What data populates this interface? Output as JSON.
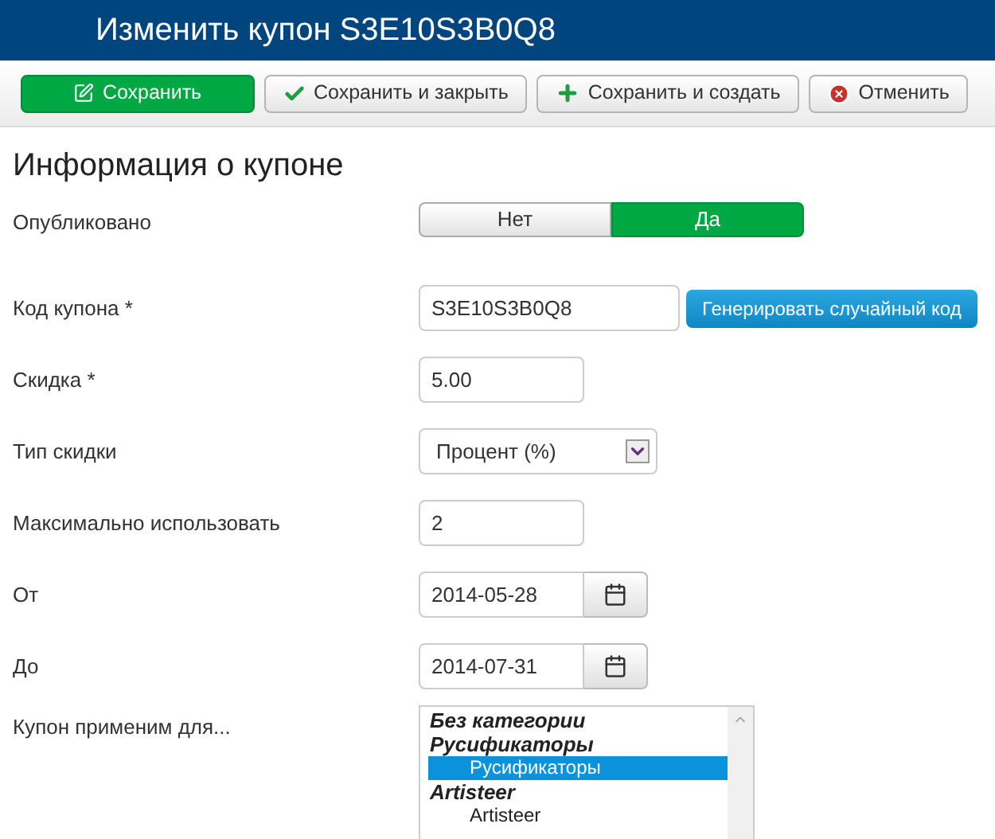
{
  "header": {
    "title": "Изменить купон S3E10S3B0Q8"
  },
  "toolbar": [
    {
      "kind": "save",
      "label": "Сохранить"
    },
    {
      "kind": "check",
      "label": "Сохранить и закрыть"
    },
    {
      "kind": "plus",
      "label": "Сохранить и создать"
    },
    {
      "kind": "cancel",
      "label": "Отменить"
    }
  ],
  "section_title": "Информация о купоне",
  "fields": [
    {
      "kind": "toggle",
      "label": "Опубликовано",
      "options": [
        {
          "label": "Нет",
          "selected": false
        },
        {
          "label": "Да",
          "selected": true
        }
      ]
    },
    {
      "kind": "text",
      "label": "Код купона *",
      "value": "S3E10S3B0Q8",
      "button": "Генерировать случайный код"
    },
    {
      "kind": "text",
      "label": "Скидка *",
      "value": "5.00"
    },
    {
      "kind": "select",
      "label": "Тип скидки",
      "value": "Процент (%)"
    },
    {
      "kind": "text",
      "label": "Максимально использовать",
      "value": "2"
    },
    {
      "kind": "date",
      "label": "От",
      "value": "2014-05-28"
    },
    {
      "kind": "date",
      "label": "До",
      "value": "2014-07-31"
    },
    {
      "kind": "list",
      "label": "Купон применим для...",
      "items": [
        {
          "kind": "group",
          "label": "Без категории"
        },
        {
          "kind": "group",
          "label": "Русификаторы"
        },
        {
          "kind": "option",
          "label": "Русификаторы",
          "selected": true
        },
        {
          "kind": "group",
          "label": "Artisteer"
        },
        {
          "kind": "option",
          "label": "Artisteer",
          "selected": false
        }
      ]
    }
  ]
}
